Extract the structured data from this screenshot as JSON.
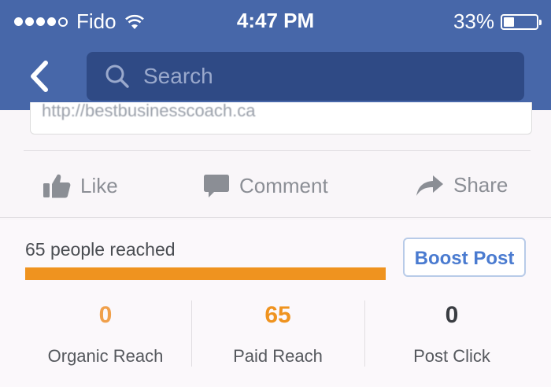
{
  "status_bar": {
    "carrier": "Fido",
    "time": "4:47 PM",
    "battery": "33%",
    "signal_bars_filled": 4,
    "signal_bars_total": 5,
    "battery_level": 0.33
  },
  "nav": {
    "back_icon": "chevron-left-icon",
    "search_placeholder": "Search"
  },
  "post": {
    "link_text": "http://bestbusinesscoach.ca"
  },
  "actions": {
    "like": "Like",
    "comment": "Comment",
    "share": "Share"
  },
  "boost": {
    "reach_text": "65 people reached",
    "reach_fraction": 1.0,
    "button_label": "Boost Post"
  },
  "stats": [
    {
      "value": "0",
      "label": "Organic Reach",
      "color": "#f0a04b"
    },
    {
      "value": "65",
      "label": "Paid Reach",
      "color": "#ef931f"
    },
    {
      "value": "0",
      "label": "Post Click",
      "color": "#3a3d42"
    }
  ],
  "colors": {
    "header": "#4767a9",
    "search_bg": "#2f4a85",
    "reach_bar": "#ef931f",
    "boost_text": "#4a7bd0"
  }
}
